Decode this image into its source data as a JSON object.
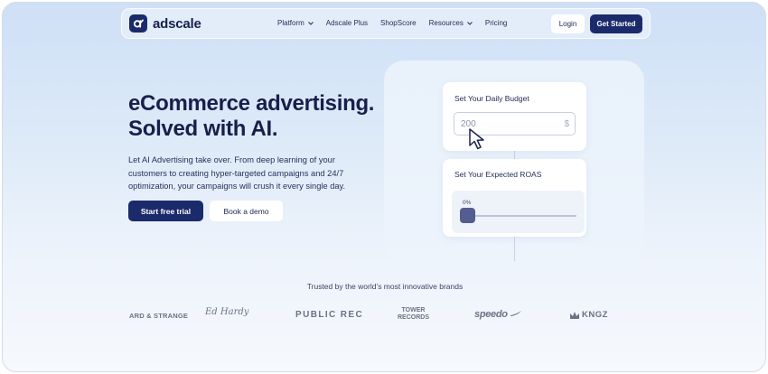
{
  "nav": {
    "brand": "adscale",
    "menu": [
      {
        "label": "Platform",
        "dropdown": true
      },
      {
        "label": "Adscale Plus",
        "dropdown": false
      },
      {
        "label": "ShopScore",
        "dropdown": false
      },
      {
        "label": "Resources",
        "dropdown": true
      },
      {
        "label": "Pricing",
        "dropdown": false
      }
    ],
    "login_label": "Login",
    "get_started_label": "Get Started"
  },
  "hero": {
    "title_line1": "eCommerce advertising.",
    "title_line2": "Solved with AI.",
    "description": "Let AI Advertising take over. From deep learning of your customers to creating hyper-targeted campaigns and 24/7 optimization, your campaigns will crush it every single day.",
    "primary_cta": "Start free trial",
    "secondary_cta": "Book a demo"
  },
  "widget": {
    "budget": {
      "title": "Set Your Daily Budget",
      "value": "200",
      "currency": "$"
    },
    "roas": {
      "title": "Set Your Expected ROAS",
      "value_label": "0%",
      "value": 0
    }
  },
  "brands": {
    "heading": "Trusted by the world’s most innovative brands",
    "items": [
      {
        "name": "ARD & STRANGE"
      },
      {
        "name": "Ed Hardy"
      },
      {
        "name": "PUBLIC REC"
      },
      {
        "name": "TOWER RECORDS",
        "line1": "TOWER",
        "line2": "RECORDS"
      },
      {
        "name": "speedo"
      },
      {
        "name": "KNGZ"
      }
    ]
  },
  "colors": {
    "primary": "#1b2a6b",
    "background_top": "#cfe0f6",
    "background_bottom": "#f6f9fd",
    "brand_logo_gray": "#6a7284"
  }
}
